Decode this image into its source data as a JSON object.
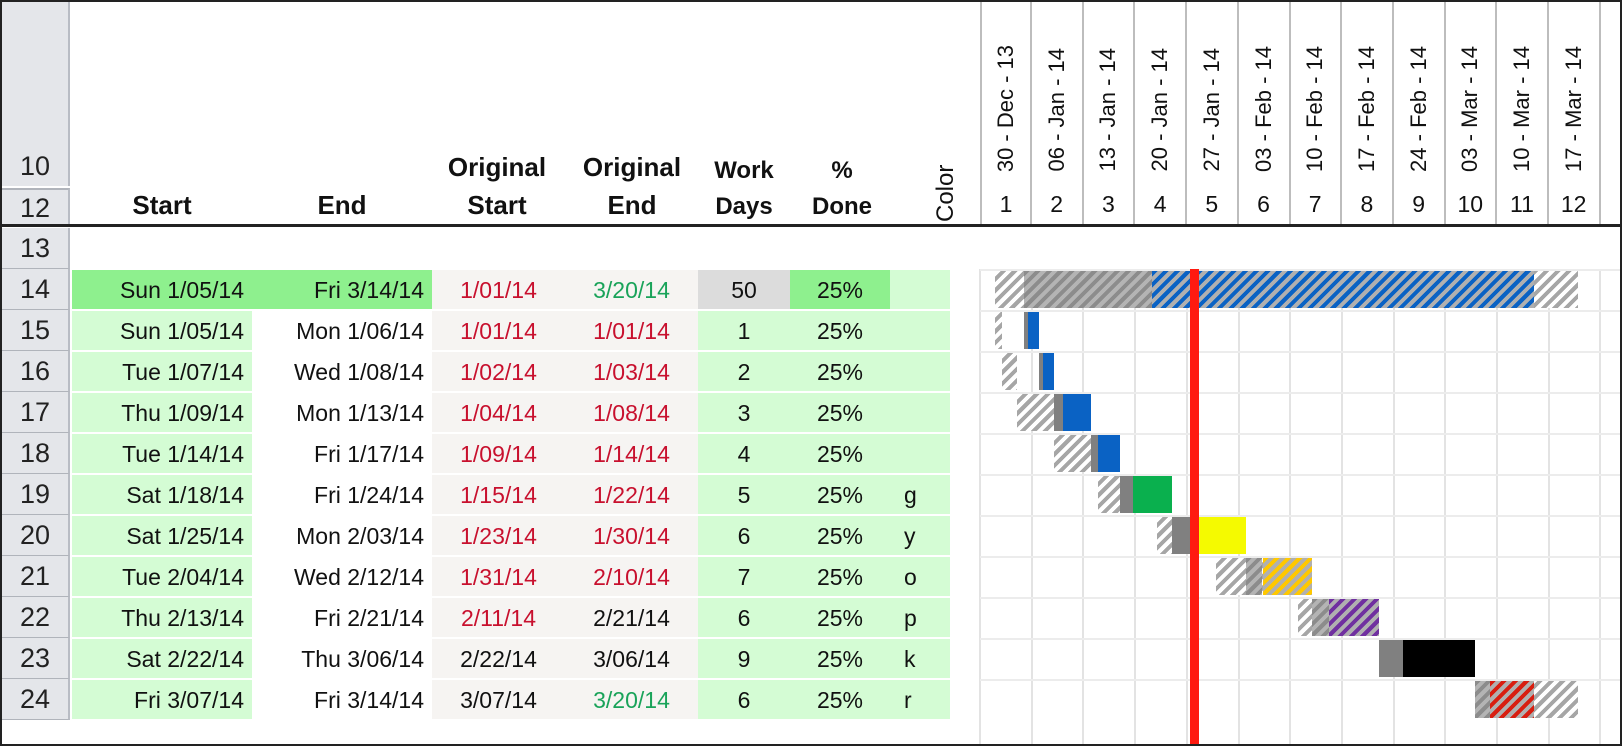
{
  "header": {
    "row_numbers": [
      "10",
      "12"
    ],
    "columns": {
      "start": "Start",
      "end": "End",
      "orig_start_1": "Original",
      "orig_start_2": "Start",
      "orig_end_1": "Original",
      "orig_end_2": "End",
      "work_1": "Work",
      "work_2": "Days",
      "done_1": "%",
      "done_2": "Done",
      "color": "Color"
    },
    "timeline": [
      {
        "date": "30 - Dec - 13",
        "week": "1"
      },
      {
        "date": "06 - Jan - 14",
        "week": "2"
      },
      {
        "date": "13 - Jan - 14",
        "week": "3"
      },
      {
        "date": "20 - Jan - 14",
        "week": "4"
      },
      {
        "date": "27 - Jan - 14",
        "week": "5"
      },
      {
        "date": "03 - Feb - 14",
        "week": "6"
      },
      {
        "date": "10 - Feb - 14",
        "week": "7"
      },
      {
        "date": "17 - Feb - 14",
        "week": "8"
      },
      {
        "date": "24 - Feb - 14",
        "week": "9"
      },
      {
        "date": "03 - Mar - 14",
        "week": "10"
      },
      {
        "date": "10 - Mar - 14",
        "week": "11"
      },
      {
        "date": "17 - Mar - 14",
        "week": "12"
      }
    ]
  },
  "colors": {
    "blue": "#0a62c4",
    "green": "#0ab04e",
    "yellow": "#f5fa00",
    "orange": "#ffc800",
    "purple": "#7030a0",
    "black": "#000000",
    "red": "#d81e10",
    "today_line": "#ff1a10",
    "summary_fill": "#8ef08e",
    "light_fill": "#d4fcd4"
  },
  "rows": [
    {
      "row": "13"
    },
    {
      "row": "14",
      "start": "Sun 1/05/14",
      "end": "Fri 3/14/14",
      "orig_start": "1/01/14",
      "orig_end": "3/20/14",
      "orig_start_color": "red",
      "orig_end_color": "green",
      "work_days": "50",
      "pct_done": "25%",
      "color_code": "",
      "summary": true
    },
    {
      "row": "15",
      "start": "Sun 1/05/14",
      "end": "Mon 1/06/14",
      "orig_start": "1/01/14",
      "orig_end": "1/01/14",
      "orig_start_color": "red",
      "orig_end_color": "red",
      "work_days": "1",
      "pct_done": "25%",
      "color_code": ""
    },
    {
      "row": "16",
      "start": "Tue 1/07/14",
      "end": "Wed 1/08/14",
      "orig_start": "1/02/14",
      "orig_end": "1/03/14",
      "orig_start_color": "red",
      "orig_end_color": "red",
      "work_days": "2",
      "pct_done": "25%",
      "color_code": ""
    },
    {
      "row": "17",
      "start": "Thu 1/09/14",
      "end": "Mon 1/13/14",
      "orig_start": "1/04/14",
      "orig_end": "1/08/14",
      "orig_start_color": "red",
      "orig_end_color": "red",
      "work_days": "3",
      "pct_done": "25%",
      "color_code": ""
    },
    {
      "row": "18",
      "start": "Tue 1/14/14",
      "end": "Fri 1/17/14",
      "orig_start": "1/09/14",
      "orig_end": "1/14/14",
      "orig_start_color": "red",
      "orig_end_color": "red",
      "work_days": "4",
      "pct_done": "25%",
      "color_code": ""
    },
    {
      "row": "19",
      "start": "Sat 1/18/14",
      "end": "Fri 1/24/14",
      "orig_start": "1/15/14",
      "orig_end": "1/22/14",
      "orig_start_color": "red",
      "orig_end_color": "red",
      "work_days": "5",
      "pct_done": "25%",
      "color_code": "g"
    },
    {
      "row": "20",
      "start": "Sat 1/25/14",
      "end": "Mon 2/03/14",
      "orig_start": "1/23/14",
      "orig_end": "1/30/14",
      "orig_start_color": "red",
      "orig_end_color": "red",
      "work_days": "6",
      "pct_done": "25%",
      "color_code": "y"
    },
    {
      "row": "21",
      "start": "Tue 2/04/14",
      "end": "Wed 2/12/14",
      "orig_start": "1/31/14",
      "orig_end": "2/10/14",
      "orig_start_color": "red",
      "orig_end_color": "red",
      "work_days": "7",
      "pct_done": "25%",
      "color_code": "o"
    },
    {
      "row": "22",
      "start": "Thu 2/13/14",
      "end": "Fri 2/21/14",
      "orig_start": "2/11/14",
      "orig_end": "2/21/14",
      "orig_start_color": "red",
      "orig_end_color": "dark",
      "work_days": "6",
      "pct_done": "25%",
      "color_code": "p"
    },
    {
      "row": "23",
      "start": "Sat 2/22/14",
      "end": "Thu 3/06/14",
      "orig_start": "2/22/14",
      "orig_end": "3/06/14",
      "orig_start_color": "dark",
      "orig_end_color": "dark",
      "work_days": "9",
      "pct_done": "25%",
      "color_code": "k"
    },
    {
      "row": "24",
      "start": "Fri 3/07/14",
      "end": "Fri 3/14/14",
      "orig_start": "3/07/14",
      "orig_end": "3/20/14",
      "orig_start_color": "dark",
      "orig_end_color": "green",
      "work_days": "6",
      "pct_done": "25%",
      "color_code": "r"
    }
  ],
  "gantt": {
    "timeline_start": "2013-12-30",
    "today": "2014-01-28",
    "bars": [
      {
        "row": "14",
        "orig_start": "2014-01-01",
        "orig_end": "2014-03-20",
        "start": "2014-01-05",
        "end": "2014-03-14",
        "color": "blue",
        "style": "hatched",
        "done_fraction": 0.25
      },
      {
        "row": "15",
        "orig_start": "2014-01-01",
        "orig_end": "2014-01-01",
        "start": "2014-01-05",
        "end": "2014-01-06",
        "color": "blue",
        "style": "solid",
        "done_fraction": 0.25
      },
      {
        "row": "16",
        "orig_start": "2014-01-02",
        "orig_end": "2014-01-03",
        "start": "2014-01-07",
        "end": "2014-01-08",
        "color": "blue",
        "style": "solid",
        "done_fraction": 0.25
      },
      {
        "row": "17",
        "orig_start": "2014-01-04",
        "orig_end": "2014-01-08",
        "start": "2014-01-09",
        "end": "2014-01-13",
        "color": "blue",
        "style": "solid",
        "done_fraction": 0.25
      },
      {
        "row": "18",
        "orig_start": "2014-01-09",
        "orig_end": "2014-01-14",
        "start": "2014-01-14",
        "end": "2014-01-17",
        "color": "blue",
        "style": "solid",
        "done_fraction": 0.25
      },
      {
        "row": "19",
        "orig_start": "2014-01-15",
        "orig_end": "2014-01-22",
        "start": "2014-01-18",
        "end": "2014-01-24",
        "color": "green",
        "style": "solid",
        "done_fraction": 0.25
      },
      {
        "row": "20",
        "orig_start": "2014-01-23",
        "orig_end": "2014-01-30",
        "start": "2014-01-25",
        "end": "2014-02-03",
        "color": "yellow",
        "style": "solid",
        "done_fraction": 0.25
      },
      {
        "row": "21",
        "orig_start": "2014-01-31",
        "orig_end": "2014-02-10",
        "start": "2014-02-04",
        "end": "2014-02-12",
        "color": "orange",
        "style": "hatched",
        "done_fraction": 0.25
      },
      {
        "row": "22",
        "orig_start": "2014-02-11",
        "orig_end": "2014-02-21",
        "start": "2014-02-13",
        "end": "2014-02-21",
        "color": "purple",
        "style": "hatched",
        "done_fraction": 0.25
      },
      {
        "row": "23",
        "orig_start": "2014-02-22",
        "orig_end": "2014-03-06",
        "start": "2014-02-22",
        "end": "2014-03-06",
        "color": "black",
        "style": "solid",
        "done_fraction": 0.25
      },
      {
        "row": "24",
        "orig_start": "2014-03-07",
        "orig_end": "2014-03-20",
        "start": "2014-03-07",
        "end": "2014-03-14",
        "color": "red",
        "style": "hatched",
        "done_fraction": 0.25
      }
    ]
  }
}
